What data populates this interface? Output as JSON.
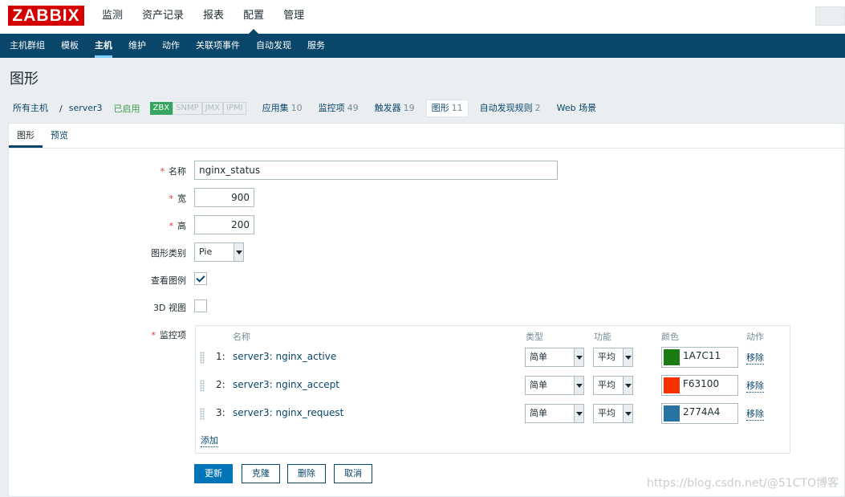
{
  "header": {
    "logo": "ZABBIX",
    "menu": [
      "监测",
      "资产记录",
      "报表",
      "配置",
      "管理"
    ],
    "active_menu": "配置"
  },
  "submenu": [
    "主机群组",
    "模板",
    "主机",
    "维护",
    "动作",
    "关联项事件",
    "自动发现",
    "服务"
  ],
  "active_submenu": "主机",
  "page_title": "图形",
  "host_nav": {
    "all_hosts": "所有主机",
    "separator": "/",
    "host": "server3",
    "status": "已启用",
    "availability": [
      "ZBX",
      "SNMP",
      "JMX",
      "IPMI"
    ],
    "links": [
      {
        "label": "应用集",
        "count": "10"
      },
      {
        "label": "监控项",
        "count": "49"
      },
      {
        "label": "触发器",
        "count": "19"
      },
      {
        "label": "图形",
        "count": "11"
      },
      {
        "label": "自动发现规则",
        "count": "2"
      },
      {
        "label": "Web 场景",
        "count": ""
      }
    ]
  },
  "tabs": [
    "图形",
    "预览"
  ],
  "form": {
    "name_label": "名称",
    "name_value": "nginx_status",
    "width_label": "宽",
    "width_value": "900",
    "height_label": "高",
    "height_value": "200",
    "graph_type_label": "图形类别",
    "graph_type_value": "Pie",
    "show_legend_label": "查看图例",
    "show_legend_checked": true,
    "view3d_label": "3D 视图",
    "view3d_checked": false,
    "items_label": "监控项",
    "columns": {
      "name": "名称",
      "type": "类型",
      "function": "功能",
      "color": "颜色",
      "action": "动作"
    },
    "items": [
      {
        "num": "1:",
        "name": "server3: nginx_active",
        "type": "简单",
        "function": "平均",
        "color": "1A7C11",
        "color_hex": "#1A7C11",
        "action": "移除"
      },
      {
        "num": "2:",
        "name": "server3: nginx_accept",
        "type": "简单",
        "function": "平均",
        "color": "F63100",
        "color_hex": "#F63100",
        "action": "移除"
      },
      {
        "num": "3:",
        "name": "server3: nginx_request",
        "type": "简单",
        "function": "平均",
        "color": "2774A4",
        "color_hex": "#2774A4",
        "action": "移除"
      }
    ],
    "add_label": "添加"
  },
  "buttons": {
    "update": "更新",
    "clone": "克隆",
    "delete": "删除",
    "cancel": "取消"
  },
  "watermark": "https://blog.csdn.net/@51CTO博客"
}
